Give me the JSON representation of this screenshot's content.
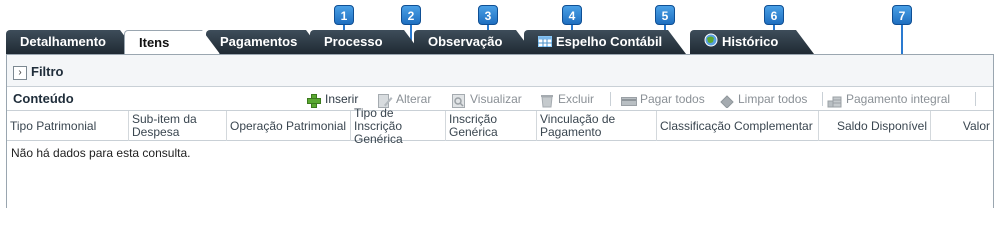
{
  "markers": [
    "1",
    "2",
    "3",
    "4",
    "5",
    "6",
    "7"
  ],
  "tabs": [
    {
      "label": "Detalhamento"
    },
    {
      "label": "Itens"
    },
    {
      "label": "Pagamentos"
    },
    {
      "label": "Processo"
    },
    {
      "label": "Observação"
    },
    {
      "label": "Espelho Contábil",
      "icon": "table-icon"
    },
    {
      "label": "Histórico",
      "icon": "globe-icon"
    }
  ],
  "filter": {
    "label": "Filtro",
    "icon": "disclosure-arrow-icon"
  },
  "toolbar": {
    "title": "Conteúdo",
    "buttons": [
      {
        "label": "Inserir",
        "icon": "plus-icon",
        "enabled": true
      },
      {
        "label": "Alterar",
        "icon": "edit-icon",
        "enabled": false
      },
      {
        "label": "Visualizar",
        "icon": "view-icon",
        "enabled": false
      },
      {
        "label": "Excluir",
        "icon": "trash-icon",
        "enabled": false
      },
      {
        "label": "Pagar todos",
        "icon": "card-icon",
        "enabled": false
      },
      {
        "label": "Limpar todos",
        "icon": "eraser-icon",
        "enabled": false
      },
      {
        "label": "Pagamento integral",
        "icon": "coins-icon",
        "enabled": false
      }
    ]
  },
  "table": {
    "columns": [
      "Tipo Patrimonial",
      "Sub-item da Despesa",
      "Operação Patrimonial",
      "Tipo de Inscrição Genérica",
      "Inscrição Genérica",
      "Vinculação de Pagamento",
      "Classificação Complementar",
      "Saldo Disponível",
      "Valor"
    ],
    "empty_message": "Não há dados para esta consulta."
  },
  "colors": {
    "marker": "#2a7ad0",
    "tab_dark": "#2b3742",
    "accent_green": "#5aa832"
  }
}
